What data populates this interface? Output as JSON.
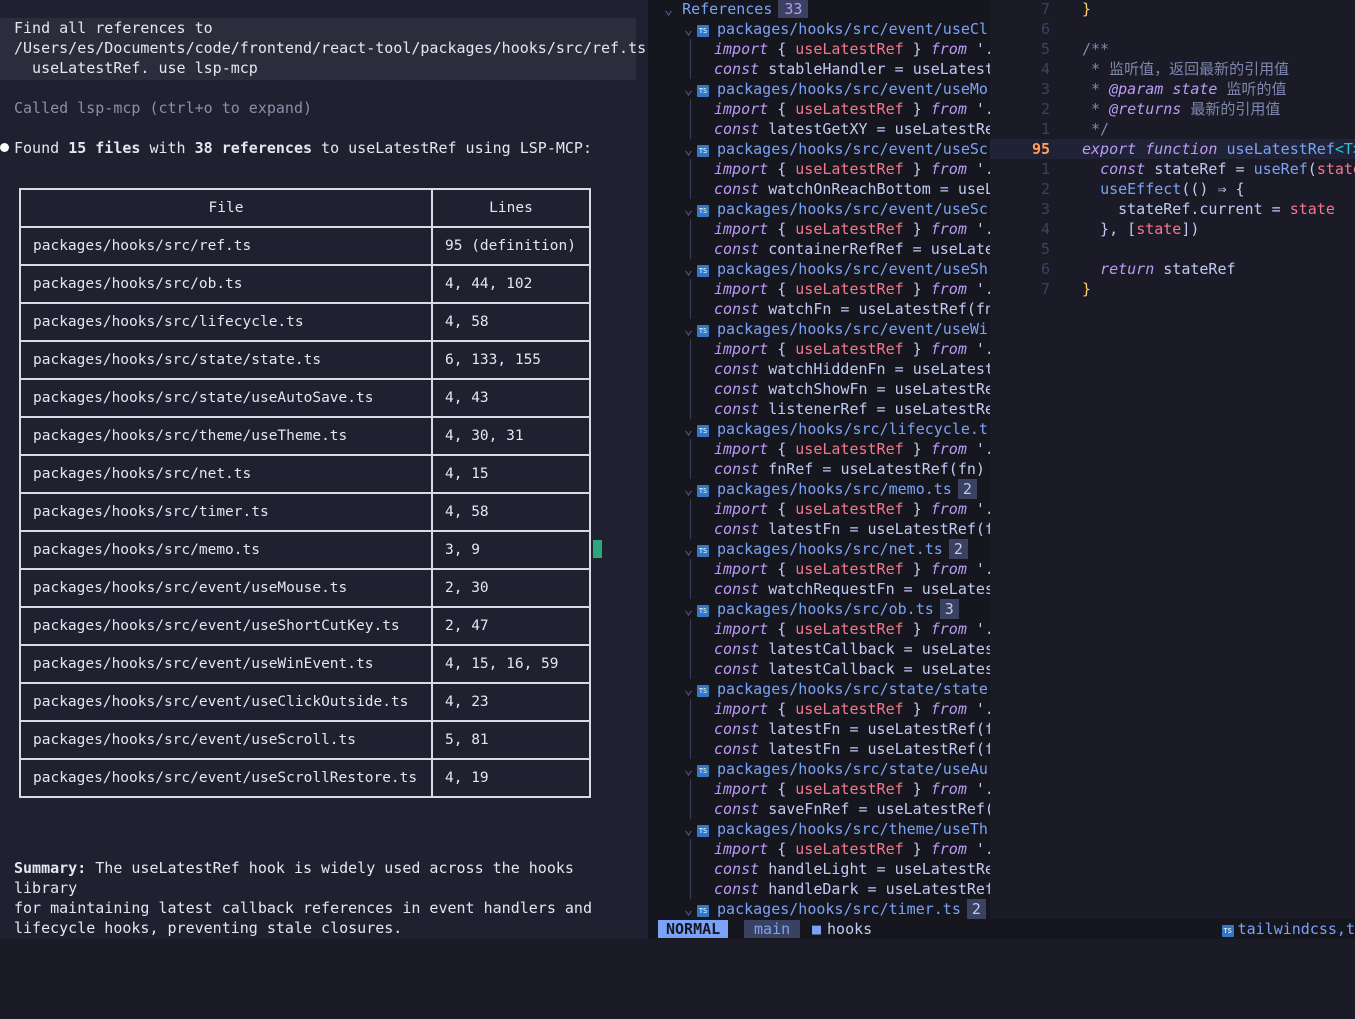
{
  "terminal": {
    "prompt_lines": [
      "Find all references to",
      "/Users/es/Documents/code/frontend/react-tool/packages/hooks/src/ref.ts",
      "  useLatestRef. use lsp-mcp"
    ],
    "called": "Called lsp-mcp (ctrl+o to expand)",
    "found_prefix": "Found ",
    "found_files": "15 files",
    "found_mid": " with ",
    "found_refs": "38 references",
    "found_suffix": " to useLatestRef using LSP-MCP:",
    "table": {
      "headers": [
        "File",
        "Lines"
      ],
      "rows": [
        [
          "packages/hooks/src/ref.ts",
          "95 (definition)"
        ],
        [
          "packages/hooks/src/ob.ts",
          "4, 44, 102"
        ],
        [
          "packages/hooks/src/lifecycle.ts",
          "4, 58"
        ],
        [
          "packages/hooks/src/state/state.ts",
          "6, 133, 155"
        ],
        [
          "packages/hooks/src/state/useAutoSave.ts",
          "4, 43"
        ],
        [
          "packages/hooks/src/theme/useTheme.ts",
          "4, 30, 31"
        ],
        [
          "packages/hooks/src/net.ts",
          "4, 15"
        ],
        [
          "packages/hooks/src/timer.ts",
          "4, 58"
        ],
        [
          "packages/hooks/src/memo.ts",
          "3, 9"
        ],
        [
          "packages/hooks/src/event/useMouse.ts",
          "2, 30"
        ],
        [
          "packages/hooks/src/event/useShortCutKey.ts",
          "2, 47"
        ],
        [
          "packages/hooks/src/event/useWinEvent.ts",
          "4, 15, 16, 59"
        ],
        [
          "packages/hooks/src/event/useClickOutside.ts",
          "4, 23"
        ],
        [
          "packages/hooks/src/event/useScroll.ts",
          "5, 81"
        ],
        [
          "packages/hooks/src/event/useScrollRestore.ts",
          "4, 19"
        ]
      ]
    },
    "summary_label": "Summary:",
    "summary_text": " The useLatestRef hook is widely used across the hooks library\nfor maintaining latest callback references in event handlers and\nlifecycle hooks, preventing stale closures."
  },
  "references": {
    "title": "References",
    "count": "33",
    "ts_icon_label": "TS",
    "rows": [
      {
        "kind": "file",
        "text": "packages/hooks/src/event/useCl"
      },
      {
        "kind": "import",
        "text": ""
      },
      {
        "kind": "const",
        "name": "stableHandler",
        "rhs": "useLatest"
      },
      {
        "kind": "file",
        "text": "packages/hooks/src/event/useMo"
      },
      {
        "kind": "import",
        "text": ""
      },
      {
        "kind": "const",
        "name": "latestGetXY",
        "rhs": "useLatestRe"
      },
      {
        "kind": "file",
        "text": "packages/hooks/src/event/useSc"
      },
      {
        "kind": "import",
        "text": ""
      },
      {
        "kind": "const",
        "name": "watchOnReachBottom",
        "rhs": "useL"
      },
      {
        "kind": "file",
        "text": "packages/hooks/src/event/useSc"
      },
      {
        "kind": "import",
        "text": ""
      },
      {
        "kind": "const",
        "name": "containerRefRef",
        "rhs": "useLate"
      },
      {
        "kind": "file",
        "text": "packages/hooks/src/event/useSh"
      },
      {
        "kind": "import",
        "text": ""
      },
      {
        "kind": "const",
        "name": "watchFn",
        "rhs": "useLatestRef(fn"
      },
      {
        "kind": "file",
        "text": "packages/hooks/src/event/useWi"
      },
      {
        "kind": "import",
        "text": ""
      },
      {
        "kind": "const",
        "name": "watchHiddenFn",
        "rhs": "useLatest"
      },
      {
        "kind": "const",
        "name": "watchShowFn",
        "rhs": "useLatestRe"
      },
      {
        "kind": "const",
        "name": "listenerRef",
        "rhs": "useLatestRe"
      },
      {
        "kind": "file",
        "text": "packages/hooks/src/lifecycle.t"
      },
      {
        "kind": "import",
        "text": ""
      },
      {
        "kind": "const",
        "name": "fnRef",
        "rhs": "useLatestRef(fn)"
      },
      {
        "kind": "file",
        "text": "packages/hooks/src/memo.ts",
        "count": "2"
      },
      {
        "kind": "import",
        "text": ""
      },
      {
        "kind": "const",
        "name": "latestFn",
        "rhs": "useLatestRef(f"
      },
      {
        "kind": "file",
        "text": "packages/hooks/src/net.ts",
        "count": "2"
      },
      {
        "kind": "import",
        "text": ""
      },
      {
        "kind": "const",
        "name": "watchRequestFn",
        "rhs": "useLates"
      },
      {
        "kind": "file",
        "text": "packages/hooks/src/ob.ts",
        "count": "3"
      },
      {
        "kind": "import",
        "text": ""
      },
      {
        "kind": "const",
        "name": "latestCallback",
        "rhs": "useLates"
      },
      {
        "kind": "const",
        "name": "latestCallback",
        "rhs": "useLates"
      },
      {
        "kind": "file",
        "text": "packages/hooks/src/state/state"
      },
      {
        "kind": "import",
        "text": ""
      },
      {
        "kind": "const",
        "name": "latestFn",
        "rhs": "useLatestRef(f"
      },
      {
        "kind": "const",
        "name": "latestFn",
        "rhs": "useLatestRef(f"
      },
      {
        "kind": "file",
        "text": "packages/hooks/src/state/useAu"
      },
      {
        "kind": "import",
        "text": ""
      },
      {
        "kind": "const",
        "name": "saveFnRef",
        "rhs": "useLatestRef("
      },
      {
        "kind": "file",
        "text": "packages/hooks/src/theme/useTh"
      },
      {
        "kind": "import",
        "text": ""
      },
      {
        "kind": "const",
        "name": "handleLight",
        "rhs": "useLatestRe"
      },
      {
        "kind": "const",
        "name": "handleDark",
        "rhs": "useLatestRef"
      },
      {
        "kind": "file",
        "text": "packages/hooks/src/timer.ts",
        "count": "2"
      }
    ],
    "import_kw": "import",
    "import_name": "useLatestRef",
    "from_kw": "from",
    "const_kw": "const"
  },
  "code": {
    "lines": [
      {
        "num": "7",
        "text": "}"
      },
      {
        "num": "6",
        "text": ""
      },
      {
        "num": "5",
        "text": "/**"
      },
      {
        "num": "4",
        "text": " * 监听值，返回最新的引用值"
      },
      {
        "num": "3",
        "text": " * @param state 监听的值"
      },
      {
        "num": "2",
        "text": " * @returns 最新的引用值"
      },
      {
        "num": "1",
        "text": " */"
      },
      {
        "num": "95",
        "text": "export function useLatestRef<T>"
      },
      {
        "num": "1",
        "text": "  const stateRef = useRef(state"
      },
      {
        "num": "2",
        "text": "  useEffect(() ⇒ {"
      },
      {
        "num": "3",
        "text": "    stateRef.current = state"
      },
      {
        "num": "4",
        "text": "  }, [state])"
      },
      {
        "num": "5",
        "text": ""
      },
      {
        "num": "6",
        "text": "  return stateRef"
      },
      {
        "num": "7",
        "text": "}"
      }
    ]
  },
  "statusline": {
    "mode": "NORMAL",
    "branch": "main",
    "dir": "hooks",
    "right": "tailwindcss,t"
  },
  "colors": {
    "accent_blue": "#7aa2f7",
    "keyword_purple": "#bb9af7",
    "ref_red": "#f7768e",
    "cursor_green": "#2ea67a",
    "line_number_orange": "#ff9e64"
  }
}
